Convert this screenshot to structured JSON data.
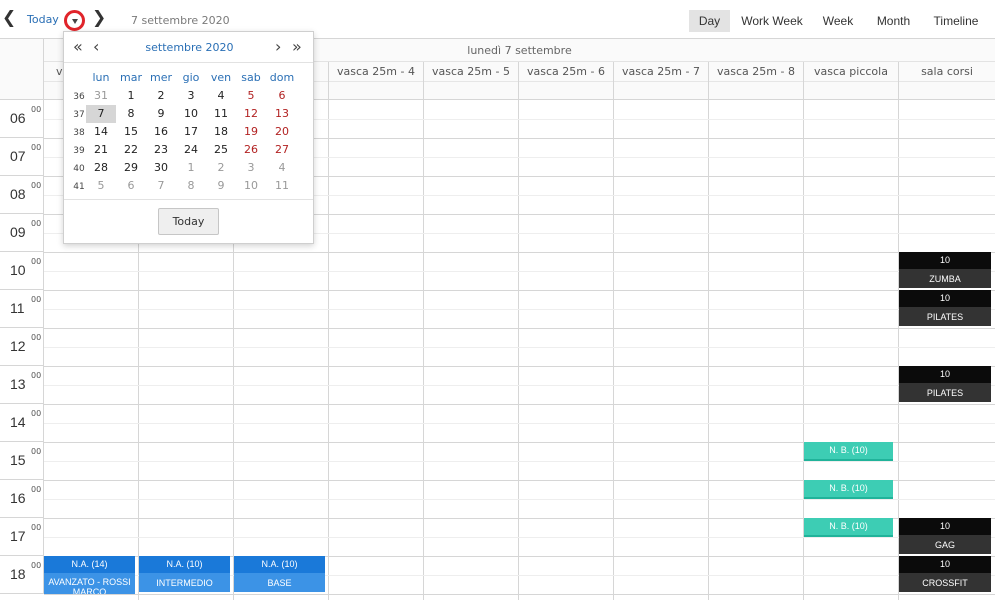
{
  "toolbar": {
    "prev_glyph": "❮",
    "next_glyph": "❯",
    "today_label": "Today",
    "current_date": "7 settembre 2020",
    "views": [
      "Day",
      "Work Week",
      "Week",
      "Month",
      "Timeline"
    ],
    "active_view": "Day"
  },
  "calendar": {
    "title": "settembre 2020",
    "prev_year_glyph": "«",
    "prev_month_glyph": "‹",
    "next_month_glyph": "›",
    "next_year_glyph": "»",
    "weekdays": [
      "lun",
      "mar",
      "mer",
      "gio",
      "ven",
      "sab",
      "dom"
    ],
    "weeks": [
      {
        "num": "36",
        "days": [
          "31",
          "1",
          "2",
          "3",
          "4",
          "5",
          "6"
        ]
      },
      {
        "num": "37",
        "days": [
          "7",
          "8",
          "9",
          "10",
          "11",
          "12",
          "13"
        ]
      },
      {
        "num": "38",
        "days": [
          "14",
          "15",
          "16",
          "17",
          "18",
          "19",
          "20"
        ]
      },
      {
        "num": "39",
        "days": [
          "21",
          "22",
          "23",
          "24",
          "25",
          "26",
          "27"
        ]
      },
      {
        "num": "40",
        "days": [
          "28",
          "29",
          "30",
          "1",
          "2",
          "3",
          "4"
        ]
      },
      {
        "num": "41",
        "days": [
          "5",
          "6",
          "7",
          "8",
          "9",
          "10",
          "11"
        ]
      }
    ],
    "selected_day": "7",
    "today_button": "Today"
  },
  "scheduler": {
    "date_header": "lunedì 7 settembre",
    "resources": [
      "v",
      "",
      "",
      "vasca 25m - 4",
      "vasca 25m - 5",
      "vasca 25m - 6",
      "vasca 25m - 7",
      "vasca 25m - 8",
      "vasca piccola",
      "sala corsi"
    ],
    "hours": [
      "06",
      "07",
      "08",
      "09",
      "10",
      "11",
      "12",
      "13",
      "14",
      "15",
      "16",
      "17",
      "18"
    ],
    "minute_label": "00"
  },
  "events": [
    {
      "top": "10",
      "bottom": "ZUMBA",
      "style": "dark"
    },
    {
      "top": "10",
      "bottom": "PILATES",
      "style": "dark"
    },
    {
      "top": "10",
      "bottom": "PILATES",
      "style": "dark"
    },
    {
      "top": "N. B. (10)",
      "bottom": "",
      "style": "teal"
    },
    {
      "top": "N. B. (10)",
      "bottom": "",
      "style": "teal"
    },
    {
      "top": "N. B. (10)",
      "bottom": "",
      "style": "teal"
    },
    {
      "top": "10",
      "bottom": "GAG",
      "style": "dark"
    },
    {
      "top": "N.A. (14)",
      "bottom": "AVANZATO - ROSSI MARCO",
      "style": "blue"
    },
    {
      "top": "N.A. (10)",
      "bottom": "INTERMEDIO",
      "style": "blue"
    },
    {
      "top": "N.A. (10)",
      "bottom": "BASE",
      "style": "blue"
    },
    {
      "top": "10",
      "bottom": "CROSSFIT",
      "style": "dark"
    }
  ]
}
